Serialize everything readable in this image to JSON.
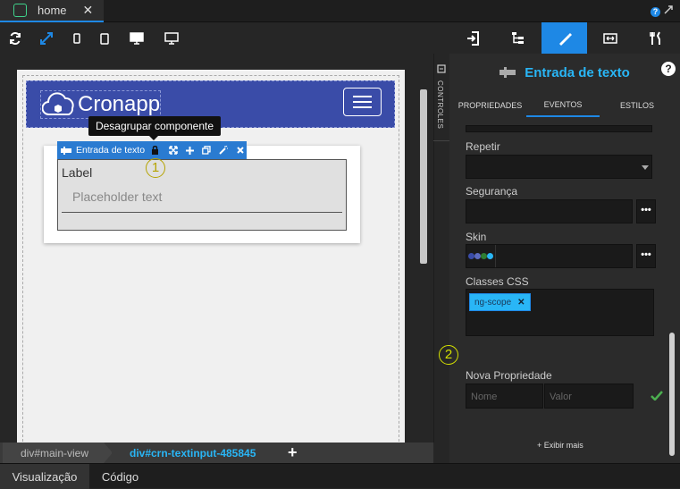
{
  "tabs": [
    {
      "label": "home",
      "close": "✕"
    }
  ],
  "top_right": {
    "help": "?"
  },
  "toolbar": {
    "icons": [
      "refresh-icon",
      "fullscreen-icon",
      "mobile-portrait-icon",
      "tablet-icon",
      "desktop-icon",
      "monitor-icon"
    ]
  },
  "controls_sidebar": {
    "label": "CONTROLES"
  },
  "canvas": {
    "logo_text": "Cronapp",
    "tooltip": "Desagrupar componente",
    "component_name": "Entrada de texto",
    "input_label": "Label",
    "input_placeholder": "Placeholder text",
    "marker1": "1"
  },
  "panel": {
    "tabs": [
      "login-icon",
      "tree-icon",
      "brush-icon",
      "resize-icon",
      "tools-icon"
    ],
    "title": "Entrada de texto",
    "help": "?",
    "subtabs": [
      "PROPRIEDADES",
      "EVENTOS",
      "ESTILOS"
    ],
    "active_subtab": "EVENTOS",
    "fields": {
      "repetir": "Repetir",
      "seguranca": "Segurança",
      "skin": "Skin",
      "classes": "Classes CSS",
      "class_tag": "ng-scope",
      "tag_remove": "✕",
      "nova": "Nova Propriedade",
      "nome_ph": "Nome",
      "valor_ph": "Valor",
      "more_btn": "•••",
      "marker2": "2"
    },
    "skin_colors": [
      "#3a4ca8",
      "#5c6bc0",
      "#2e7d32",
      "#29b6f6"
    ],
    "show_more": "+ Exibir mais"
  },
  "breadcrumb": {
    "items": [
      "div#main-view",
      "div#crn-textinput-485845"
    ],
    "add": "+"
  },
  "bottom_tabs": [
    "Visualização",
    "Código"
  ],
  "colors": {
    "accent": "#1e88e5",
    "title": "#29b6f6",
    "navbar": "#3a4ca8",
    "marker1": "#b5a300",
    "marker2": "#d4e000",
    "confirm": "#4caf50"
  }
}
